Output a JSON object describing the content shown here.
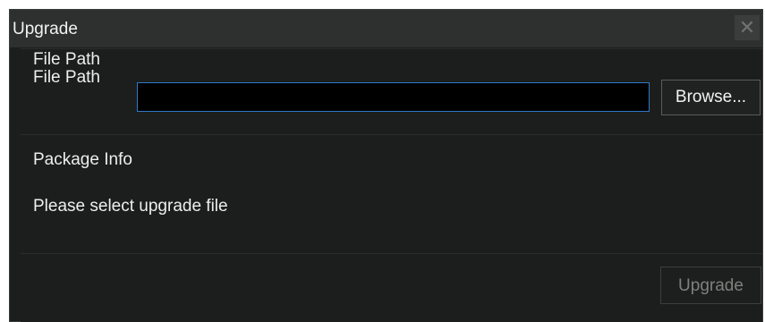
{
  "dialog": {
    "title": "Upgrade",
    "close_icon": "close-icon",
    "close_glyph": "✕"
  },
  "file_section": {
    "heading": "File Path",
    "field_label": "File Path",
    "path_value": "",
    "path_placeholder": "",
    "browse_label": "Browse..."
  },
  "package_section": {
    "heading": "Package Info",
    "message": "Please select upgrade file"
  },
  "footer": {
    "upgrade_label": "Upgrade",
    "upgrade_enabled": false
  },
  "colors": {
    "background": "#1b1e1c",
    "titlebar": "#2d302e",
    "input_border_accent": "#2f78c8",
    "disabled_text": "#7d817e"
  }
}
